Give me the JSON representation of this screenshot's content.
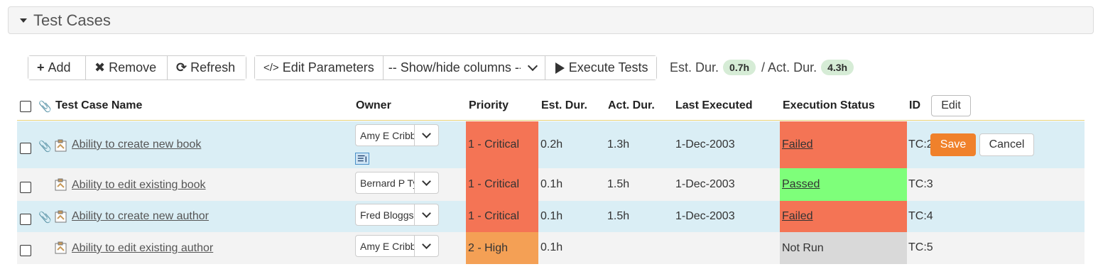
{
  "panel": {
    "title": "Test Cases"
  },
  "toolbar": {
    "add_label": "Add",
    "remove_label": "Remove",
    "refresh_label": "Refresh",
    "edit_params_label": "Edit Parameters",
    "show_hide_label": "-- Show/hide columns --",
    "execute_label": "Execute Tests",
    "est_dur_label": "Est. Dur.",
    "est_dur_value": "0.7h",
    "act_dur_label": "/ Act. Dur.",
    "act_dur_value": "4.3h"
  },
  "table": {
    "headers": {
      "name": "Test Case Name",
      "owner": "Owner",
      "priority": "Priority",
      "est": "Est. Dur.",
      "act": "Act. Dur.",
      "last": "Last Executed",
      "status": "Execution Status",
      "id": "ID",
      "edit": "Edit"
    },
    "rows": [
      {
        "name": "Ability to create new book",
        "owner": "Amy E Cribbins",
        "priority": "1 - Critical",
        "est": "0.2h",
        "act": "1.3h",
        "last": "1-Dec-2003",
        "status": "Failed",
        "id": "TC:2",
        "save": "Save",
        "cancel": "Cancel"
      },
      {
        "name": "Ability to edit existing book",
        "owner": "Bernard P Tyler",
        "priority": "1 - Critical",
        "est": "0.1h",
        "act": "1.5h",
        "last": "1-Dec-2003",
        "status": "Passed",
        "id": "TC:3"
      },
      {
        "name": "Ability to create new author",
        "owner": "Fred Bloggs",
        "priority": "1 - Critical",
        "est": "0.1h",
        "act": "1.5h",
        "last": "1-Dec-2003",
        "status": "Failed",
        "id": "TC:4"
      },
      {
        "name": "Ability to edit existing author",
        "owner": "Amy E Cribbins",
        "priority": "2 - High",
        "est": "0.1h",
        "act": "",
        "last": "",
        "status": "Not Run",
        "id": "TC:5"
      }
    ]
  },
  "colors": {
    "critical": "#f47455",
    "high": "#f4a055",
    "failed": "#f47455",
    "passed": "#7eff7a",
    "not_run": "#d9d9d9",
    "save": "#f0812b"
  }
}
